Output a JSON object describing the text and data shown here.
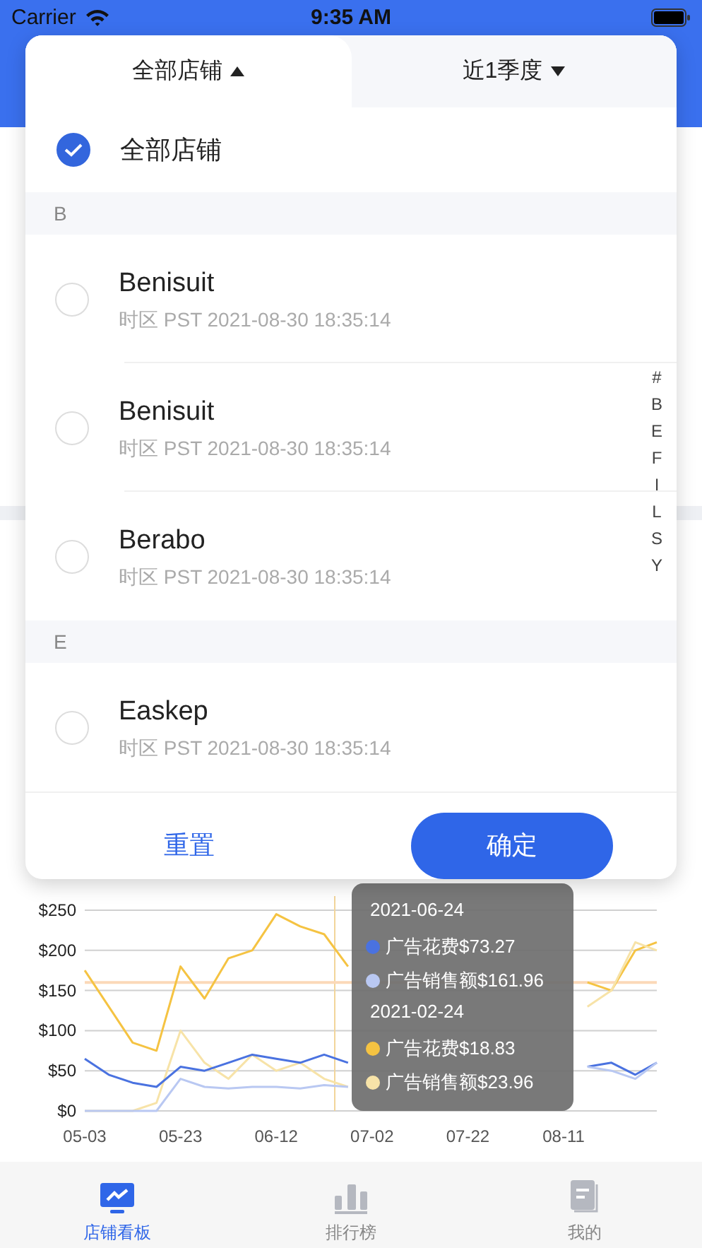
{
  "status_bar": {
    "carrier": "Carrier",
    "time": "9:35 AM"
  },
  "filter_tabs": [
    {
      "label": "全部店铺",
      "selected": true
    },
    {
      "label": "近1季度",
      "selected": false
    }
  ],
  "all_option": {
    "label": "全部店铺",
    "selected": true
  },
  "sections": [
    {
      "letter": "B",
      "stores": [
        {
          "name": "Benisuit",
          "detail": "时区 PST 2021-08-30 18:35:14",
          "selected": false
        },
        {
          "name": "Benisuit",
          "detail": "时区 PST 2021-08-30 18:35:14",
          "selected": false
        },
        {
          "name": "Berabo",
          "detail": "时区 PST 2021-08-30 18:35:14",
          "selected": false
        }
      ]
    },
    {
      "letter": "E",
      "stores": [
        {
          "name": "Easkep",
          "detail": "时区 PST 2021-08-30 18:35:14",
          "selected": false
        }
      ]
    }
  ],
  "index_letters": [
    "#",
    "B",
    "E",
    "F",
    "I",
    "L",
    "S",
    "Y"
  ],
  "reset_button": "重置",
  "confirm_button": "确定",
  "chart_data": {
    "type": "line",
    "categories": [
      "05-03",
      null,
      null,
      null,
      "05-23",
      null,
      null,
      null,
      "06-12",
      null,
      null,
      null,
      "07-02",
      null,
      null,
      null,
      "07-22",
      null,
      null,
      null,
      "08-11",
      null,
      null,
      null,
      null
    ],
    "ylim": [
      0,
      250
    ],
    "grid": true,
    "yticks": [
      {
        "value": 0,
        "label": "$0"
      },
      {
        "value": 50,
        "label": "$50"
      },
      {
        "value": 100,
        "label": "$100"
      },
      {
        "value": 150,
        "label": "$150"
      },
      {
        "value": 200,
        "label": "$200"
      },
      {
        "value": 250,
        "label": "$250"
      }
    ],
    "series": [
      {
        "color": "#f5c342",
        "values": [
          175,
          130,
          85,
          75,
          180,
          140,
          190,
          200,
          245,
          230,
          220,
          180,
          null,
          null,
          null,
          null,
          null,
          null,
          null,
          null,
          null,
          160,
          150,
          200,
          210
        ]
      },
      {
        "color": "#f7e3a8",
        "values": [
          0,
          0,
          0,
          10,
          100,
          60,
          40,
          70,
          50,
          60,
          40,
          30,
          null,
          null,
          null,
          null,
          null,
          null,
          null,
          null,
          null,
          130,
          150,
          210,
          200
        ]
      },
      {
        "color": "#4a72e0",
        "values": [
          65,
          45,
          35,
          30,
          55,
          50,
          60,
          70,
          65,
          60,
          70,
          60,
          null,
          null,
          null,
          null,
          null,
          null,
          null,
          null,
          null,
          55,
          60,
          45,
          60
        ]
      },
      {
        "color": "#b9c8f2",
        "values": [
          0,
          0,
          0,
          0,
          40,
          30,
          28,
          30,
          30,
          28,
          32,
          30,
          null,
          null,
          null,
          null,
          null,
          null,
          null,
          null,
          null,
          55,
          50,
          40,
          60
        ]
      }
    ],
    "ref_lines": [
      {
        "axis": "y",
        "value": 160
      }
    ]
  },
  "tooltip": {
    "groups": [
      {
        "date": "2021-06-24",
        "items": [
          {
            "text": "广告花费$73.27",
            "color": "#4a72e0"
          },
          {
            "text": "广告销售额$161.96",
            "color": "#b9c8f2"
          }
        ]
      },
      {
        "date": "2021-02-24",
        "items": [
          {
            "text": "广告花费$18.83",
            "color": "#f5c342"
          },
          {
            "text": "广告销售额$23.96",
            "color": "#f7e3a8"
          }
        ]
      }
    ]
  },
  "tab_bar": [
    {
      "label": "店铺看板",
      "kind": "dashboard",
      "selected": true
    },
    {
      "label": "排行榜",
      "kind": "ranking",
      "selected": false
    },
    {
      "label": "我的",
      "kind": "profile",
      "selected": false
    }
  ]
}
